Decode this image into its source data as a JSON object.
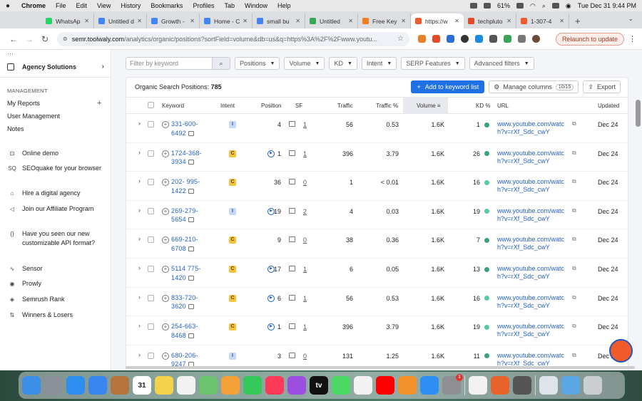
{
  "menubar": {
    "app": "Chrome",
    "items": [
      "File",
      "Edit",
      "View",
      "History",
      "Bookmarks",
      "Profiles",
      "Tab",
      "Window",
      "Help"
    ],
    "battery": "61%",
    "datetime": "Tue Dec 31  9:44 PM"
  },
  "tabs": [
    {
      "label": "WhatsAp",
      "color": "#25d366"
    },
    {
      "label": "Untitled d",
      "color": "#4285f4"
    },
    {
      "label": "Growth -",
      "color": "#4285f4"
    },
    {
      "label": "Home - C",
      "color": "#4285f4"
    },
    {
      "label": "small bu",
      "color": "#4285f4"
    },
    {
      "label": "Untitled",
      "color": "#34a853"
    },
    {
      "label": "Free Key",
      "color": "#f57c20"
    },
    {
      "label": "https://w",
      "color": "#f05a2c",
      "active": true
    },
    {
      "label": "techpluto",
      "color": "#e04b2a"
    },
    {
      "label": "1-307-4",
      "color": "#f05a2c"
    }
  ],
  "toolbar": {
    "url_host": "semr.toolwaly.com",
    "url_path": "/analytics/organic/positions?sortField=volume&db=us&q=https%3A%2F%2Fwww.youtu...",
    "relaunch": "Relaunch to update"
  },
  "sidebar": {
    "agency": "Agency Solutions",
    "management_heading": "MANAGEMENT",
    "my_reports": "My Reports",
    "user_management": "User Management",
    "notes": "Notes",
    "items": [
      {
        "icon": "monitor-icon",
        "glyph": "⊡",
        "label": "Online demo"
      },
      {
        "icon": "seoquake-icon",
        "glyph": "SQ",
        "label": "SEOquake for your browser"
      },
      {
        "icon": "agency-icon",
        "glyph": "⌂",
        "label": "Hire a digital agency"
      },
      {
        "icon": "megaphone-icon",
        "glyph": "◁",
        "label": "Join our Affiliate Program"
      },
      {
        "icon": "api-icon",
        "glyph": "{}",
        "label": "Have you seen our new customizable API format?"
      },
      {
        "icon": "sensor-icon",
        "glyph": "∿",
        "label": "Sensor"
      },
      {
        "icon": "prowly-icon",
        "glyph": "◉",
        "label": "Prowly"
      },
      {
        "icon": "rank-icon",
        "glyph": "◈",
        "label": "Semrush Rank"
      },
      {
        "icon": "arrows-icon",
        "glyph": "⇅",
        "label": "Winners & Losers"
      }
    ]
  },
  "filters": {
    "search_placeholder": "Filter by keyword",
    "dropdowns": [
      "Positions",
      "Volume",
      "KD",
      "Intent",
      "SERP Features",
      "Advanced filters"
    ]
  },
  "table": {
    "title_prefix": "Organic Search Positions:",
    "title_count": "785",
    "add_button": "Add to keyword list",
    "manage_button": "Manage columns",
    "manage_badge": "10/15",
    "export_button": "Export",
    "columns": {
      "keyword": "Keyword",
      "intent": "Intent",
      "position": "Position",
      "sf": "SF",
      "traffic": "Traffic",
      "traffic_pct": "Traffic %",
      "volume": "Volume",
      "kd": "KD %",
      "url": "URL",
      "updated": "Updated"
    },
    "rows": [
      {
        "kw1": "331-600-",
        "kw2": "6492",
        "intent": "I",
        "feature": false,
        "position": "4",
        "sf": "1",
        "traffic": "56",
        "traffic_pct": "0.53",
        "volume": "1.6K",
        "kd": "1",
        "kd_color": "#3aa27a",
        "url1": "www.youtube.com/watc",
        "url2": "h?v=rXf_Sdc_cwY",
        "updated": "Dec 24"
      },
      {
        "kw1": "1724-368-",
        "kw2": "3934",
        "intent": "C",
        "feature": true,
        "position": "1",
        "sf": "1",
        "traffic": "396",
        "traffic_pct": "3.79",
        "volume": "1.6K",
        "kd": "26",
        "kd_color": "#3aa27a",
        "url1": "www.youtube.com/watc",
        "url2": "h?v=rXf_Sdc_cwY",
        "updated": "Dec 24"
      },
      {
        "kw1": "202- 995-",
        "kw2": "1422",
        "intent": "C",
        "feature": false,
        "position": "36",
        "sf": "0",
        "traffic": "1",
        "traffic_pct": "< 0.01",
        "volume": "1.6K",
        "kd": "16",
        "kd_color": "#57c9a2",
        "url1": "www.youtube.com/watc",
        "url2": "h?v=rXf_Sdc_cwY",
        "updated": "Dec 24"
      },
      {
        "kw1": "269-279-",
        "kw2": "5654",
        "intent": "I",
        "feature": true,
        "position": "19",
        "sf": "2",
        "traffic": "4",
        "traffic_pct": "0.03",
        "volume": "1.6K",
        "kd": "19",
        "kd_color": "#57c9a2",
        "url1": "www.youtube.com/watc",
        "url2": "h?v=rXf_Sdc_cwY",
        "updated": "Dec 24"
      },
      {
        "kw1": "669-210-",
        "kw2": "6708",
        "intent": "C",
        "feature": false,
        "position": "9",
        "sf": "0",
        "traffic": "38",
        "traffic_pct": "0.36",
        "volume": "1.6K",
        "kd": "7",
        "kd_color": "#3aa27a",
        "url1": "www.youtube.com/watc",
        "url2": "h?v=rXf_Sdc_cwY",
        "updated": "Dec 24"
      },
      {
        "kw1": "5114 775-",
        "kw2": "1420",
        "intent": "C",
        "feature": true,
        "position": "17",
        "sf": "1",
        "traffic": "6",
        "traffic_pct": "0.05",
        "volume": "1.6K",
        "kd": "13",
        "kd_color": "#3aa27a",
        "url1": "www.youtube.com/watc",
        "url2": "h?v=rXf_Sdc_cwY",
        "updated": "Dec 24"
      },
      {
        "kw1": "833-720-",
        "kw2": "3620",
        "intent": "C",
        "feature": true,
        "position": "6",
        "sf": "1",
        "traffic": "56",
        "traffic_pct": "0.53",
        "volume": "1.6K",
        "kd": "16",
        "kd_color": "#57c9a2",
        "url1": "www.youtube.com/watc",
        "url2": "h?v=rXf_Sdc_cwY",
        "updated": "Dec 24"
      },
      {
        "kw1": "254-663-",
        "kw2": "8468",
        "intent": "C",
        "feature": true,
        "position": "1",
        "sf": "1",
        "traffic": "396",
        "traffic_pct": "3.79",
        "volume": "1.6K",
        "kd": "19",
        "kd_color": "#57c9a2",
        "url1": "www.youtube.com/watc",
        "url2": "h?v=rXf_Sdc_cwY",
        "updated": "Dec 24"
      },
      {
        "kw1": "680-206-",
        "kw2": "9247",
        "intent": "I",
        "feature": false,
        "position": "3",
        "sf": "0",
        "traffic": "131",
        "traffic_pct": "1.25",
        "volume": "1.6K",
        "kd": "11",
        "kd_color": "#3aa27a",
        "url1": "www.youtube.com/watc",
        "url2": "h?v=rXf_Sdc_cwY",
        "updated": "Dec 2"
      }
    ]
  },
  "dock": [
    {
      "icon": "finder-icon",
      "color": "#3b8fe8"
    },
    {
      "icon": "launchpad-icon",
      "color": "#8a8f98"
    },
    {
      "icon": "safari-icon",
      "color": "#2d8ef0"
    },
    {
      "icon": "mail-icon",
      "color": "#3a86f0"
    },
    {
      "icon": "notebook-icon",
      "color": "#b4743c"
    },
    {
      "icon": "calendar-icon",
      "color": "#ffffff",
      "text": "31",
      "text_color": "#222"
    },
    {
      "icon": "notes-icon",
      "color": "#f6d24a"
    },
    {
      "icon": "reminders-icon",
      "color": "#f2f2f2"
    },
    {
      "icon": "maps-icon",
      "color": "#6cc36d"
    },
    {
      "icon": "photos-icon",
      "color": "#f4a13a"
    },
    {
      "icon": "facetime-icon",
      "color": "#34c759"
    },
    {
      "icon": "music-icon",
      "color": "#fb3b57"
    },
    {
      "icon": "podcasts-icon",
      "color": "#9b4ee0"
    },
    {
      "icon": "tv-icon",
      "color": "#111111",
      "text": "tv"
    },
    {
      "icon": "messages-icon",
      "color": "#4cd964"
    },
    {
      "icon": "news-icon",
      "color": "#f2f2f2"
    },
    {
      "icon": "youtube-icon",
      "color": "#ff0000"
    },
    {
      "icon": "books-icon",
      "color": "#f3922a"
    },
    {
      "icon": "appstore-icon",
      "color": "#2f8ef3"
    },
    {
      "icon": "settings-icon",
      "color": "#8e8e93",
      "badge": "1"
    },
    {
      "icon": "chrome-icon",
      "color": "#f2f2f2"
    },
    {
      "icon": "firefox-icon",
      "color": "#e8622b"
    },
    {
      "icon": "calculator-icon",
      "color": "#555555"
    },
    {
      "icon": "preview-icon",
      "color": "#dfe4ea"
    },
    {
      "icon": "folder-icon",
      "color": "#5ba7e6"
    },
    {
      "icon": "trash-icon",
      "color": "#c9ced3"
    }
  ]
}
